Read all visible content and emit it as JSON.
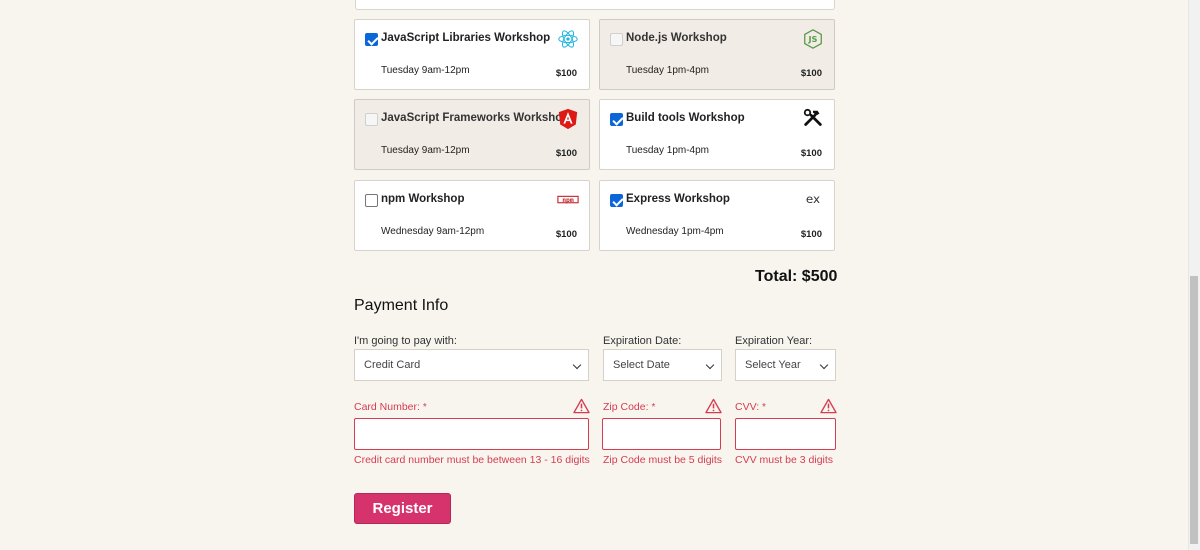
{
  "workshops": [
    {
      "name": "JavaScript Libraries Workshop",
      "time": "Tuesday 9am-12pm",
      "price": "$100",
      "checked": true,
      "disabled": false,
      "logo": "react-icon"
    },
    {
      "name": "Node.js Workshop",
      "time": "Tuesday 1pm-4pm",
      "price": "$100",
      "checked": false,
      "disabled": true,
      "logo": "nodejs-icon"
    },
    {
      "name": "JavaScript Frameworks Workshop",
      "time": "Tuesday 9am-12pm",
      "price": "$100",
      "checked": false,
      "disabled": true,
      "logo": "angular-icon"
    },
    {
      "name": "Build tools Workshop",
      "time": "Tuesday 1pm-4pm",
      "price": "$100",
      "checked": true,
      "disabled": false,
      "logo": "tools-icon"
    },
    {
      "name": "npm Workshop",
      "time": "Wednesday 9am-12pm",
      "price": "$100",
      "checked": false,
      "disabled": false,
      "logo": "npm-icon"
    },
    {
      "name": "Express Workshop",
      "time": "Wednesday 1pm-4pm",
      "price": "$100",
      "checked": true,
      "disabled": false,
      "logo": "express-icon"
    }
  ],
  "total": "Total: $500",
  "payment": {
    "title": "Payment Info",
    "pay_with_label": "I'm going to pay with:",
    "pay_with_value": "Credit Card",
    "exp_date_label": "Expiration Date:",
    "exp_date_value": "Select Date",
    "exp_year_label": "Expiration Year:",
    "exp_year_value": "Select Year",
    "card_label": "Card Number:",
    "zip_label": "Zip Code:",
    "cvv_label": "CVV:",
    "required_mark": "*",
    "card_error": "Credit card number must be between 13 - 16 digits",
    "zip_error": "Zip Code must be 5 digits",
    "cvv_error": "CVV must be 3 digits"
  },
  "register_label": "Register",
  "colors": {
    "error": "#d63c51",
    "register": "#d6336c",
    "checkbox": "#0b67d8",
    "background": "#f8f5ef"
  }
}
